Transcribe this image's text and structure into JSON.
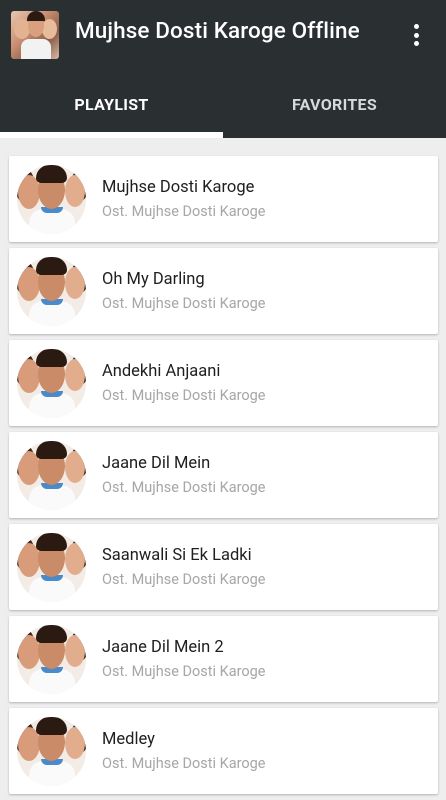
{
  "app": {
    "title": "Mujhse Dosti Karoge Offline",
    "icon": "app-poster-icon",
    "menu_icon": "overflow-menu-icon"
  },
  "tabs": [
    {
      "label": "PLAYLIST",
      "selected": true
    },
    {
      "label": "FAVORITES",
      "selected": false
    }
  ],
  "colors": {
    "appbar": "#2a2f32",
    "background": "#eeeeee",
    "card": "#ffffff",
    "title_text": "#1f1f1f",
    "subtitle_text": "#a6a6a6"
  },
  "songs": [
    {
      "title": "Mujhse Dosti Karoge",
      "subtitle": "Ost. Mujhse Dosti Karoge"
    },
    {
      "title": "Oh My Darling",
      "subtitle": "Ost. Mujhse Dosti Karoge"
    },
    {
      "title": "Andekhi Anjaani",
      "subtitle": "Ost. Mujhse Dosti Karoge"
    },
    {
      "title": "Jaane Dil Mein",
      "subtitle": "Ost. Mujhse Dosti Karoge"
    },
    {
      "title": "Saanwali Si Ek Ladki",
      "subtitle": "Ost. Mujhse Dosti Karoge"
    },
    {
      "title": "Jaane Dil Mein 2",
      "subtitle": "Ost. Mujhse Dosti Karoge"
    },
    {
      "title": "Medley",
      "subtitle": "Ost. Mujhse Dosti Karoge"
    }
  ]
}
